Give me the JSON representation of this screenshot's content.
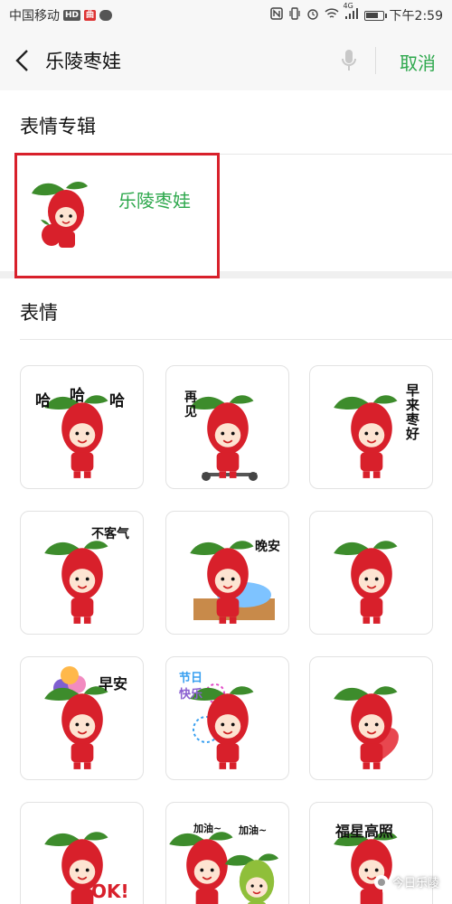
{
  "status_bar": {
    "carrier": "中国移动",
    "hd_badge": "HD",
    "app_badge": "曲",
    "network": "4G",
    "time": "下午2:59",
    "battery_fraction": 0.75
  },
  "search_bar": {
    "query": "乐陵枣娃",
    "cancel_label": "取消"
  },
  "sections": {
    "albums_title": "表情专辑",
    "stickers_title": "表情"
  },
  "album": {
    "name": "乐陵枣娃",
    "highlight_color": "#d8202b"
  },
  "stickers": [
    {
      "icon": "jujube-laughing",
      "texts": [
        "哈",
        "哈",
        "哈"
      ]
    },
    {
      "icon": "jujube-scooter-goodbye",
      "texts": [
        "再",
        "见"
      ]
    },
    {
      "icon": "jujube-good-morning",
      "texts": [
        "早",
        "来",
        "枣",
        "好"
      ]
    },
    {
      "icon": "jujube-you-are-welcome",
      "texts": [
        "不客气"
      ]
    },
    {
      "icon": "jujube-good-night-bed",
      "texts": [
        "晚安"
      ]
    },
    {
      "icon": "jujube-crying",
      "texts": []
    },
    {
      "icon": "jujube-balloons-morning",
      "texts": [
        "早安"
      ]
    },
    {
      "icon": "jujube-happy-holiday-fireworks",
      "texts": [
        "节日",
        "快乐"
      ]
    },
    {
      "icon": "jujube-heart",
      "texts": []
    },
    {
      "icon": "jujube-ok",
      "texts": [
        "OK!"
      ]
    },
    {
      "icon": "jujube-cheering-pair",
      "texts": [
        "加油~",
        "加油~"
      ]
    },
    {
      "icon": "jujube-good-fortune",
      "texts": [
        "福星高照"
      ]
    }
  ],
  "watermark": "今日乐陵",
  "colors": {
    "accent_green": "#2ea84d",
    "jujube_red": "#d8202b",
    "leaf_green": "#3d8c2c"
  }
}
